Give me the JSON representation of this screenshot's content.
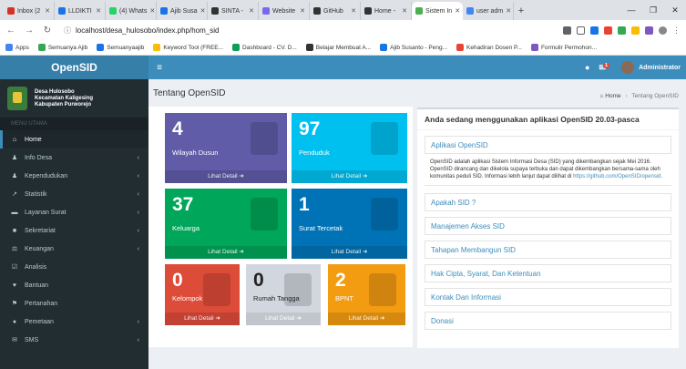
{
  "browser": {
    "tabs": [
      {
        "label": "Inbox (2",
        "color": "#d93025"
      },
      {
        "label": "LLDIKTI",
        "color": "#1a73e8"
      },
      {
        "label": "(4) Whats",
        "color": "#25d366"
      },
      {
        "label": "Ajib Susa",
        "color": "#1a73e8"
      },
      {
        "label": "SINTA -",
        "color": "#333333"
      },
      {
        "label": "Website",
        "color": "#7b68ee"
      },
      {
        "label": "GitHub",
        "color": "#333333"
      },
      {
        "label": "Home -",
        "color": "#333333"
      },
      {
        "label": "Sistem In",
        "color": "#4caf50",
        "active": true
      },
      {
        "label": "user adm",
        "color": "#4285f4"
      }
    ],
    "new_tab": "+",
    "url": "localhost/desa_hulosobo/index.php/hom_sid",
    "bookmarks": [
      {
        "label": "Apps",
        "color": "#4285f4"
      },
      {
        "label": "Semuanya Ajib",
        "color": "#34a853"
      },
      {
        "label": "Semuanyaajib",
        "color": "#1a73e8"
      },
      {
        "label": "Keyword Tool (FREE...",
        "color": "#fbbc05"
      },
      {
        "label": "Dashboard - CV. D...",
        "color": "#0f9d58"
      },
      {
        "label": "Belajar Membuat A...",
        "color": "#333333"
      },
      {
        "label": "Ajib Susanto - Peng...",
        "color": "#1a73e8"
      },
      {
        "label": "Kehadiran Dosen P...",
        "color": "#ea4335"
      },
      {
        "label": "Formulir Permohon...",
        "color": "#7e57c2"
      }
    ]
  },
  "app": {
    "logo": "OpenSID",
    "user": "Administrator",
    "notif_count": "1"
  },
  "sidebar": {
    "village_lines": [
      "Desa Hulosobo",
      "Kecamatan Kaligesing",
      "Kabupaten Purworejo"
    ],
    "menu_header": "MENU UTAMA",
    "items": [
      {
        "label": "Home",
        "icon": "home-icon",
        "glyph": "⌂",
        "active": true,
        "chev": false
      },
      {
        "label": "Info Desa",
        "icon": "users-icon",
        "glyph": "♟",
        "chev": true
      },
      {
        "label": "Kependudukan",
        "icon": "group-icon",
        "glyph": "♟",
        "chev": true
      },
      {
        "label": "Statistik",
        "icon": "line-chart-icon",
        "glyph": "↗",
        "chev": true
      },
      {
        "label": "Layanan Surat",
        "icon": "book-icon",
        "glyph": "▬",
        "chev": true
      },
      {
        "label": "Sekretariat",
        "icon": "archive-icon",
        "glyph": "■",
        "chev": true
      },
      {
        "label": "Keuangan",
        "icon": "balance-icon",
        "glyph": "⚖",
        "chev": true
      },
      {
        "label": "Analisis",
        "icon": "check-icon",
        "glyph": "☑",
        "chev": false
      },
      {
        "label": "Bantuan",
        "icon": "heart-icon",
        "glyph": "♥",
        "chev": false
      },
      {
        "label": "Pertanahan",
        "icon": "map-signs-icon",
        "glyph": "⚑",
        "chev": false
      },
      {
        "label": "Pemetaan",
        "icon": "globe-icon",
        "glyph": "●",
        "chev": true
      },
      {
        "label": "SMS",
        "icon": "envelope-icon",
        "glyph": "✉",
        "chev": true
      }
    ]
  },
  "page": {
    "title": "Tentang OpenSID",
    "breadcrumb_home": "Home",
    "breadcrumb_current": "Tentang OpenSID"
  },
  "stats": [
    {
      "value": "4",
      "label": "Wilayah Dusun",
      "link": "Lihat Detail ➜",
      "color": "#605ca8"
    },
    {
      "value": "97",
      "label": "Penduduk",
      "link": "Lihat Detail ➜",
      "color": "#00c0ef"
    },
    {
      "value": "37",
      "label": "Keluarga",
      "link": "Lihat Detail ➜",
      "color": "#00a65a"
    },
    {
      "value": "1",
      "label": "Surat Tercetak",
      "link": "Lihat Detail ➜",
      "color": "#0073b7"
    },
    {
      "value": "0",
      "label": "Kelompok",
      "link": "Lihat Detail ➜",
      "color": "#dd4b39"
    },
    {
      "value": "0",
      "label": "Rumah Tangga",
      "link": "Lihat Detail ➜",
      "color": "#d2d6de"
    },
    {
      "value": "2",
      "label": "BPNT",
      "link": "Lihat Detail ➜",
      "color": "#f39c12"
    }
  ],
  "panel": {
    "title": "Anda sedang menggunakan aplikasi OpenSID 20.03-pasca",
    "section1": "Aplikasi OpenSID",
    "body": "OpenSID adalah aplikasi Sistem Informasi Desa (SID) yang dikembangkan sejak Mei 2016. OpenSID dirancang dan dikelola supaya terbuka dan dapat dikembangkan bersama-sama oleh komunitas peduli SID. Informasi lebih lanjut dapat dilihat di",
    "body_link": "https://github.com/OpenSID/opensid.",
    "links": [
      "Apakah SID ?",
      "Manajemen Akses SID",
      "Tahapan Membangun SID",
      "Hak Cipta, Syarat, Dan Ketentuan",
      "Kontak Dan Informasi",
      "Donasi"
    ]
  }
}
